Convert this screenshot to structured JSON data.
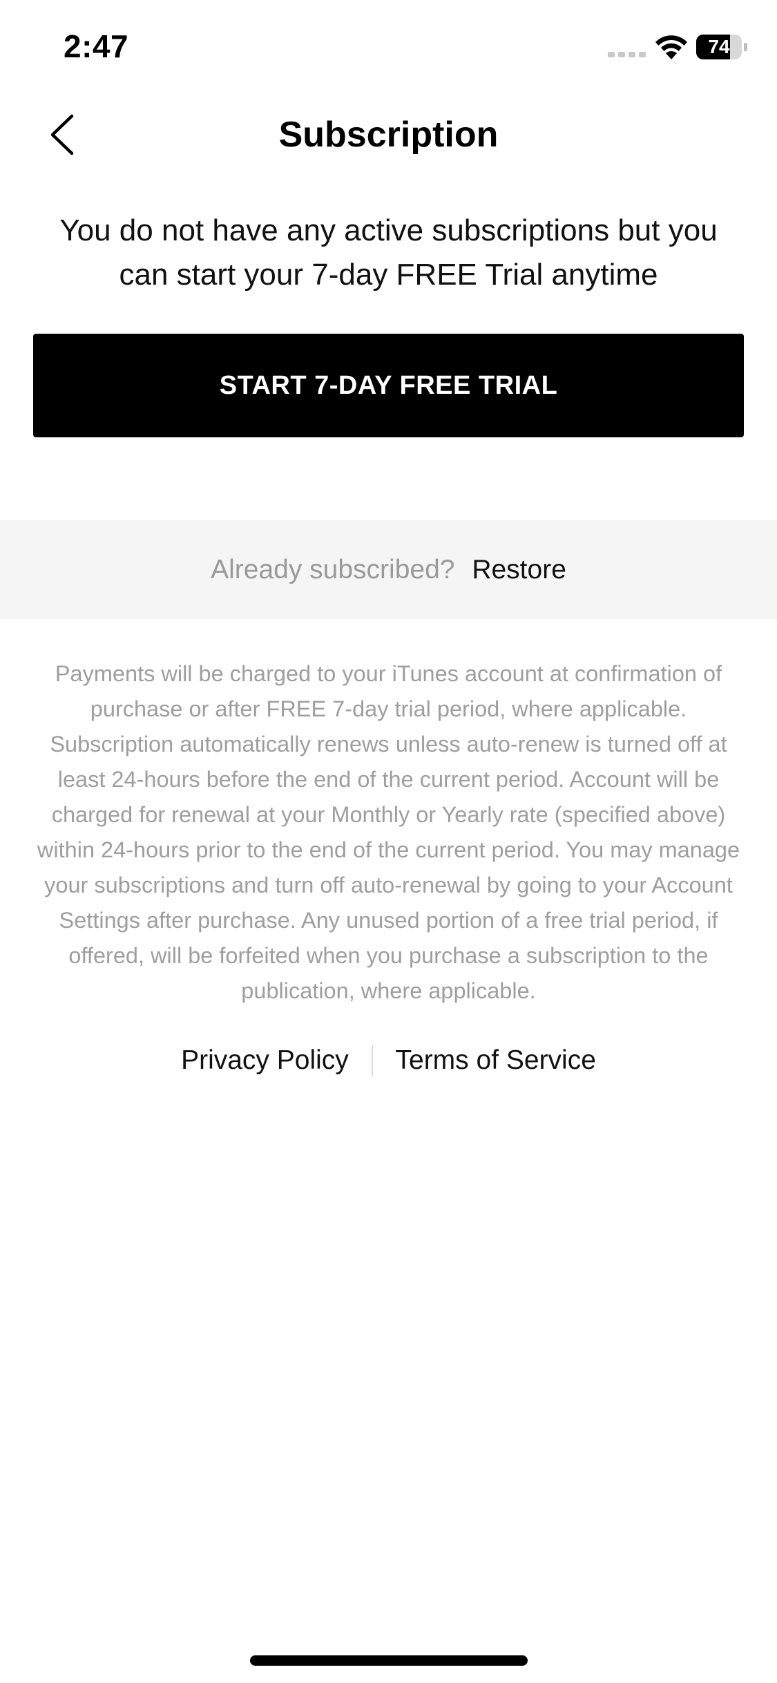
{
  "status_bar": {
    "time": "2:47",
    "battery_level": "74",
    "battery_fraction": 0.74,
    "signal_icon": "cellular-signal-icon",
    "wifi_icon": "wifi-icon"
  },
  "nav": {
    "title": "Subscription",
    "back_icon": "chevron-left-icon"
  },
  "main": {
    "message": "You do not have any active subscriptions but you can start your 7-day FREE Trial anytime",
    "trial_button_label": "START 7-DAY FREE TRIAL"
  },
  "restore": {
    "prompt": "Already subscribed?",
    "link_label": "Restore"
  },
  "legal": {
    "text": "Payments will be charged to your iTunes account at confirmation of purchase or after FREE 7-day trial period, where applicable. Subscription automatically renews unless auto-renew is turned off at least 24-hours before the end of the current period. Account will be charged for renewal at your Monthly or Yearly rate (specified above) within 24-hours prior to the end of the current period. You may manage your subscriptions and turn off auto-renewal by going to your Account Settings after purchase. Any unused portion of a free trial period, if offered, will be forfeited when you purchase a subscription to the publication, where applicable."
  },
  "footer": {
    "privacy_label": "Privacy Policy",
    "terms_label": "Terms of Service"
  },
  "colors": {
    "button_bg": "#000000",
    "button_text": "#ffffff",
    "restore_band_bg": "#f5f5f5",
    "muted_text": "#9e9e9e"
  }
}
